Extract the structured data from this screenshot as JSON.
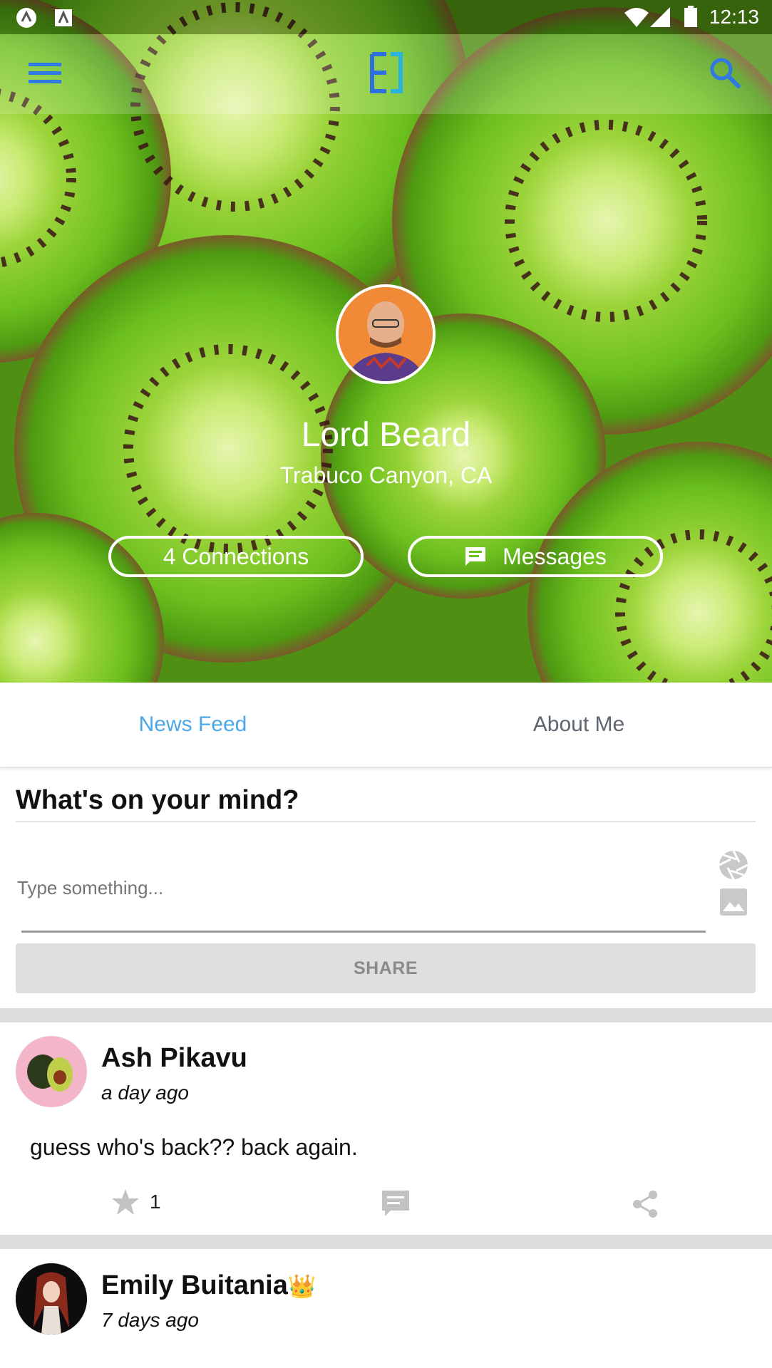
{
  "status_bar": {
    "time": "12:13"
  },
  "app_bar": {
    "menu_icon": "hamburger-menu-icon",
    "logo_icon": "app-logo-icon",
    "search_icon": "search-icon"
  },
  "profile": {
    "name": "Lord Beard",
    "location": "Trabuco Canyon, CA",
    "connections_label": "4 Connections",
    "messages_label": "Messages"
  },
  "tabs": [
    {
      "label": "News Feed",
      "active": true
    },
    {
      "label": "About Me",
      "active": false
    }
  ],
  "composer": {
    "title": "What's on your mind?",
    "placeholder": "Type something...",
    "share_label": "SHARE"
  },
  "posts": [
    {
      "author": "Ash Pikavu",
      "time": "a day ago",
      "body": "guess who's back?? back again.",
      "stars": "1"
    },
    {
      "author": "Emily Buitania",
      "badge": "👑",
      "time": "7 days ago"
    }
  ],
  "colors": {
    "accent": "#4aa8e8",
    "tab_inactive": "#5c6570",
    "kiwi_green": "#6cc01e"
  }
}
